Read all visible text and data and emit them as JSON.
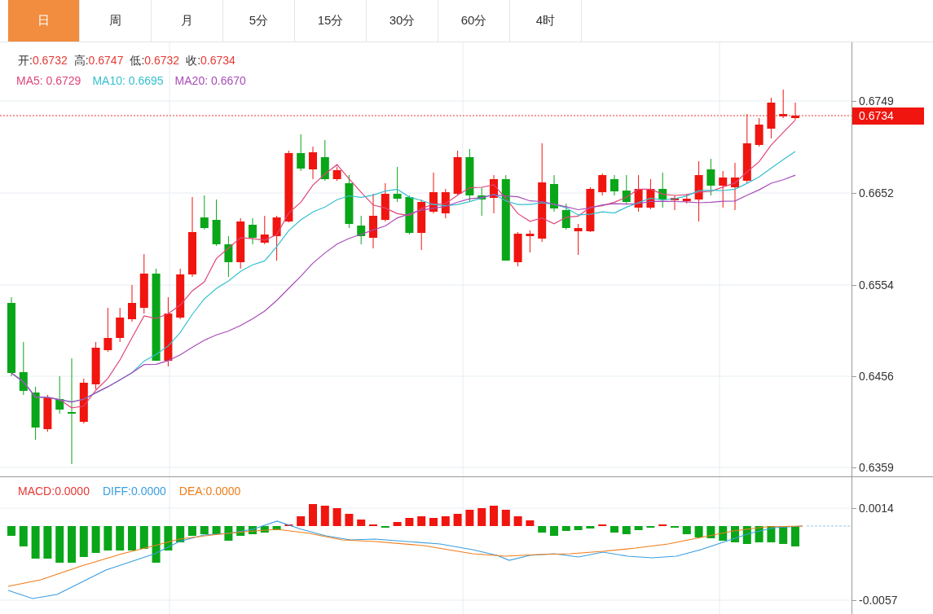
{
  "tabs": [
    {
      "label": "日",
      "selected": true
    },
    {
      "label": "周",
      "selected": false
    },
    {
      "label": "月",
      "selected": false
    },
    {
      "label": "5分",
      "selected": false
    },
    {
      "label": "15分",
      "selected": false
    },
    {
      "label": "30分",
      "selected": false
    },
    {
      "label": "60分",
      "selected": false
    },
    {
      "label": "4时",
      "selected": false
    }
  ],
  "ohlc": [
    {
      "label": "开:",
      "value": "0.6732"
    },
    {
      "label": "高:",
      "value": "0.6747"
    },
    {
      "label": "低:",
      "value": "0.6732"
    },
    {
      "label": "收:",
      "value": "0.6734"
    }
  ],
  "ma_legend": [
    {
      "label": "MA5:",
      "value": "0.6729",
      "color": "#e0457b"
    },
    {
      "label": "MA10:",
      "value": "0.6695",
      "color": "#35c0d0"
    },
    {
      "label": "MA20:",
      "value": "0.6670",
      "color": "#a84cb8"
    }
  ],
  "price_axis": [
    "0.6749",
    "0.6652",
    "0.6554",
    "0.6456",
    "0.6359"
  ],
  "current_price": "0.6734",
  "macd_legend": [
    {
      "label": "MACD:",
      "value": "0.0000",
      "color": "#e53935"
    },
    {
      "label": "DIFF:",
      "value": "0.0000",
      "color": "#3a9ee0"
    },
    {
      "label": "DEA:",
      "value": "0.0000",
      "color": "#f07c1a"
    }
  ],
  "macd_axis": [
    "0.0014",
    "-0.0057"
  ]
}
